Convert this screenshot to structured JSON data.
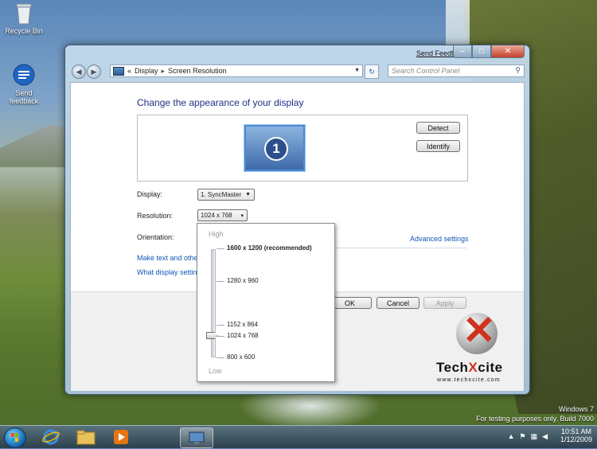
{
  "desktop": {
    "icons": [
      {
        "label": "Recycle Bin"
      },
      {
        "label": "Send feedback"
      }
    ],
    "watermark": {
      "line1": "Windows 7",
      "line2": "For testing purposes only. Build 7000"
    }
  },
  "window": {
    "send_feedback": "Send Feedback",
    "caption": {
      "minimize": "–",
      "maximize": "□",
      "close": "✕"
    },
    "breadcrumb": {
      "chevrons": "«",
      "part1": "Display",
      "separator": "▸",
      "part2": "Screen Resolution"
    },
    "search": {
      "placeholder": "Search Control Panel"
    },
    "heading": "Change the appearance of your display",
    "monitor_number": "1",
    "detect_label": "Detect",
    "identify_label": "Identify",
    "display": {
      "label": "Display:",
      "value": "1. SyncMaster"
    },
    "resolution": {
      "label": "Resolution:",
      "value": "1024 x 768"
    },
    "orientation": {
      "label": "Orientation:"
    },
    "advanced_settings": "Advanced settings",
    "link_make_text": "Make text and other",
    "link_what_display": "What display setting",
    "ok_label": "OK",
    "cancel_label": "Cancel",
    "apply_label": "Apply"
  },
  "resolution_popup": {
    "high_label": "High",
    "low_label": "Low",
    "options": [
      {
        "label": "1600 x 1200 (recommended)"
      },
      {
        "label": "1280 x 960"
      },
      {
        "label": "1152 x 864"
      },
      {
        "label": "1024 x 768"
      },
      {
        "label": "800 x 600"
      }
    ],
    "selected": "1024 x 768"
  },
  "logo": {
    "brand_part1": "Tech",
    "brand_x": "X",
    "brand_part2": "cite",
    "url": "www.techxcite.com"
  },
  "taskbar": {
    "time": "10:51 AM",
    "date": "1/12/2009"
  },
  "colors": {
    "link": "#0e58b7",
    "heading": "#1e3287",
    "accent_red": "#d0321d"
  }
}
